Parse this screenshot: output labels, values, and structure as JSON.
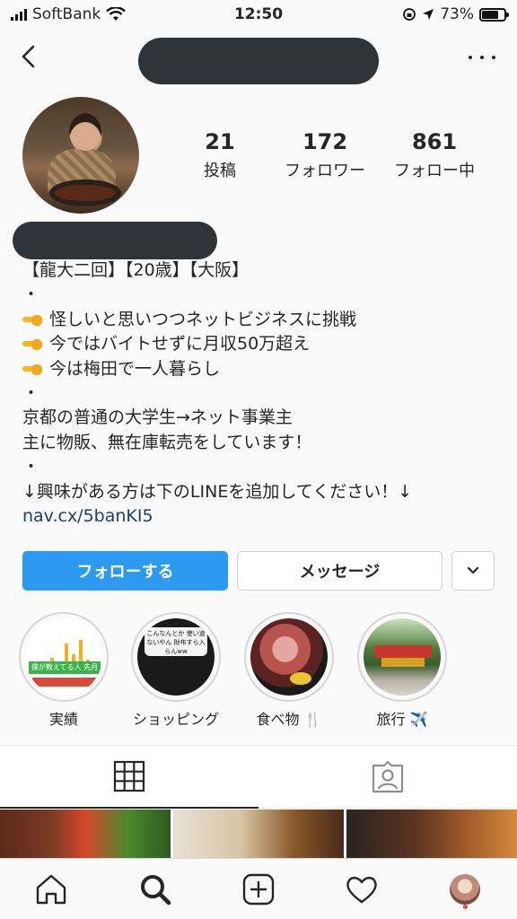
{
  "status_bar": {
    "carrier": "SoftBank",
    "time": "12:50",
    "battery": "73%",
    "battery_level": 0.73
  },
  "header": {
    "back_icon": "chevron-left-icon",
    "more_icon": "more-horizontal-icon"
  },
  "profile": {
    "stats": [
      {
        "value": "21",
        "label": "投稿"
      },
      {
        "value": "172",
        "label": "フォロワー"
      },
      {
        "value": "861",
        "label": "フォロー中"
      }
    ],
    "bio": {
      "line1": "【龍大二回】【20歳】【大阪】",
      "dot": "・",
      "line2": "怪しいと思いつつネットビジネスに挑戦",
      "line3": "今ではバイトせずに月収50万超え",
      "line4": "今は梅田で一人暮らし",
      "line5": "京都の普通の大学生→ネット事業主",
      "line6": "主に物販、無在庫転売をしています！",
      "line7": "↓興味がある方は下のLINEを追加してください！↓",
      "link": "nav.cx/5banKI5"
    }
  },
  "buttons": {
    "follow": "フォローする",
    "message": "メッセージ"
  },
  "highlights": [
    {
      "label": "実績",
      "cover_text": "僕が教えてる人 先月行ききった"
    },
    {
      "label": "ショッピング",
      "cover_text": "こんなんとか 使い道ないやん 財布すら入らんww"
    },
    {
      "label": "食べ物 🍴",
      "cover_text": ""
    },
    {
      "label": "旅行 ✈️",
      "cover_text": ""
    }
  ],
  "tabs": {
    "grid_icon": "grid-icon",
    "tagged_icon": "tagged-person-icon"
  },
  "bottom_nav": {
    "items": [
      "home-icon",
      "search-icon",
      "new-post-icon",
      "heart-icon",
      "profile-avatar"
    ]
  },
  "colors": {
    "follow_button": "#2d9af1",
    "link": "#1e3d6b",
    "notification_dot": "#ed4956"
  }
}
